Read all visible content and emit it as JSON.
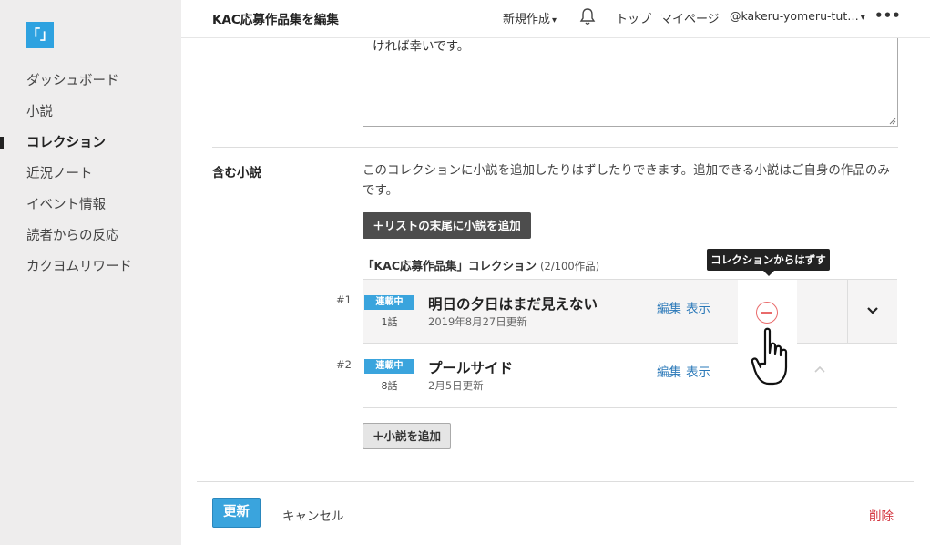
{
  "sidebar": {
    "logo_text": "「」",
    "items": [
      {
        "label": "ダッシュボード",
        "active": false
      },
      {
        "label": "小説",
        "active": false
      },
      {
        "label": "コレクション",
        "active": true
      },
      {
        "label": "近況ノート",
        "active": false
      },
      {
        "label": "イベント情報",
        "active": false
      },
      {
        "label": "読者からの反応",
        "active": false
      },
      {
        "label": "カクヨムリワード",
        "active": false
      }
    ]
  },
  "header": {
    "title": "KAC応募作品集を編集",
    "new_post": "新規作成",
    "top": "トップ",
    "mypage": "マイページ",
    "account": "@kakeru-yomeru-tut…",
    "more": "•••"
  },
  "description_field": {
    "visible_text": "ければ幸いです。"
  },
  "novels_section": {
    "label": "含む小説",
    "description": "このコレクションに小説を追加したりはずしたりできます。追加できる小説はご自身の作品のみです。",
    "add_to_end_button": "＋リストの末尾に小説を追加",
    "collection_title": "「KAC応募作品集」コレクション",
    "collection_count": "(2/100作品)",
    "tooltip": "コレクションからはずす",
    "novels": [
      {
        "number": "#1",
        "status": "連載中",
        "episodes": "1話",
        "title": "明日の夕日はまだ見えない",
        "updated": "2019年8月27日更新",
        "edit": "編集",
        "view": "表示"
      },
      {
        "number": "#2",
        "status": "連載中",
        "episodes": "8話",
        "title": "プールサイド",
        "updated": "2月5日更新",
        "edit": "編集",
        "view": "表示"
      }
    ],
    "add_novel_button": "＋小説を追加"
  },
  "footer": {
    "update": "更新",
    "cancel": "キャンセル",
    "delete": "削除"
  },
  "colors": {
    "accent": "#3aa4dd",
    "delete": "#d4343e",
    "remove_icon": "#e96b6b",
    "link": "#2a78b8"
  }
}
